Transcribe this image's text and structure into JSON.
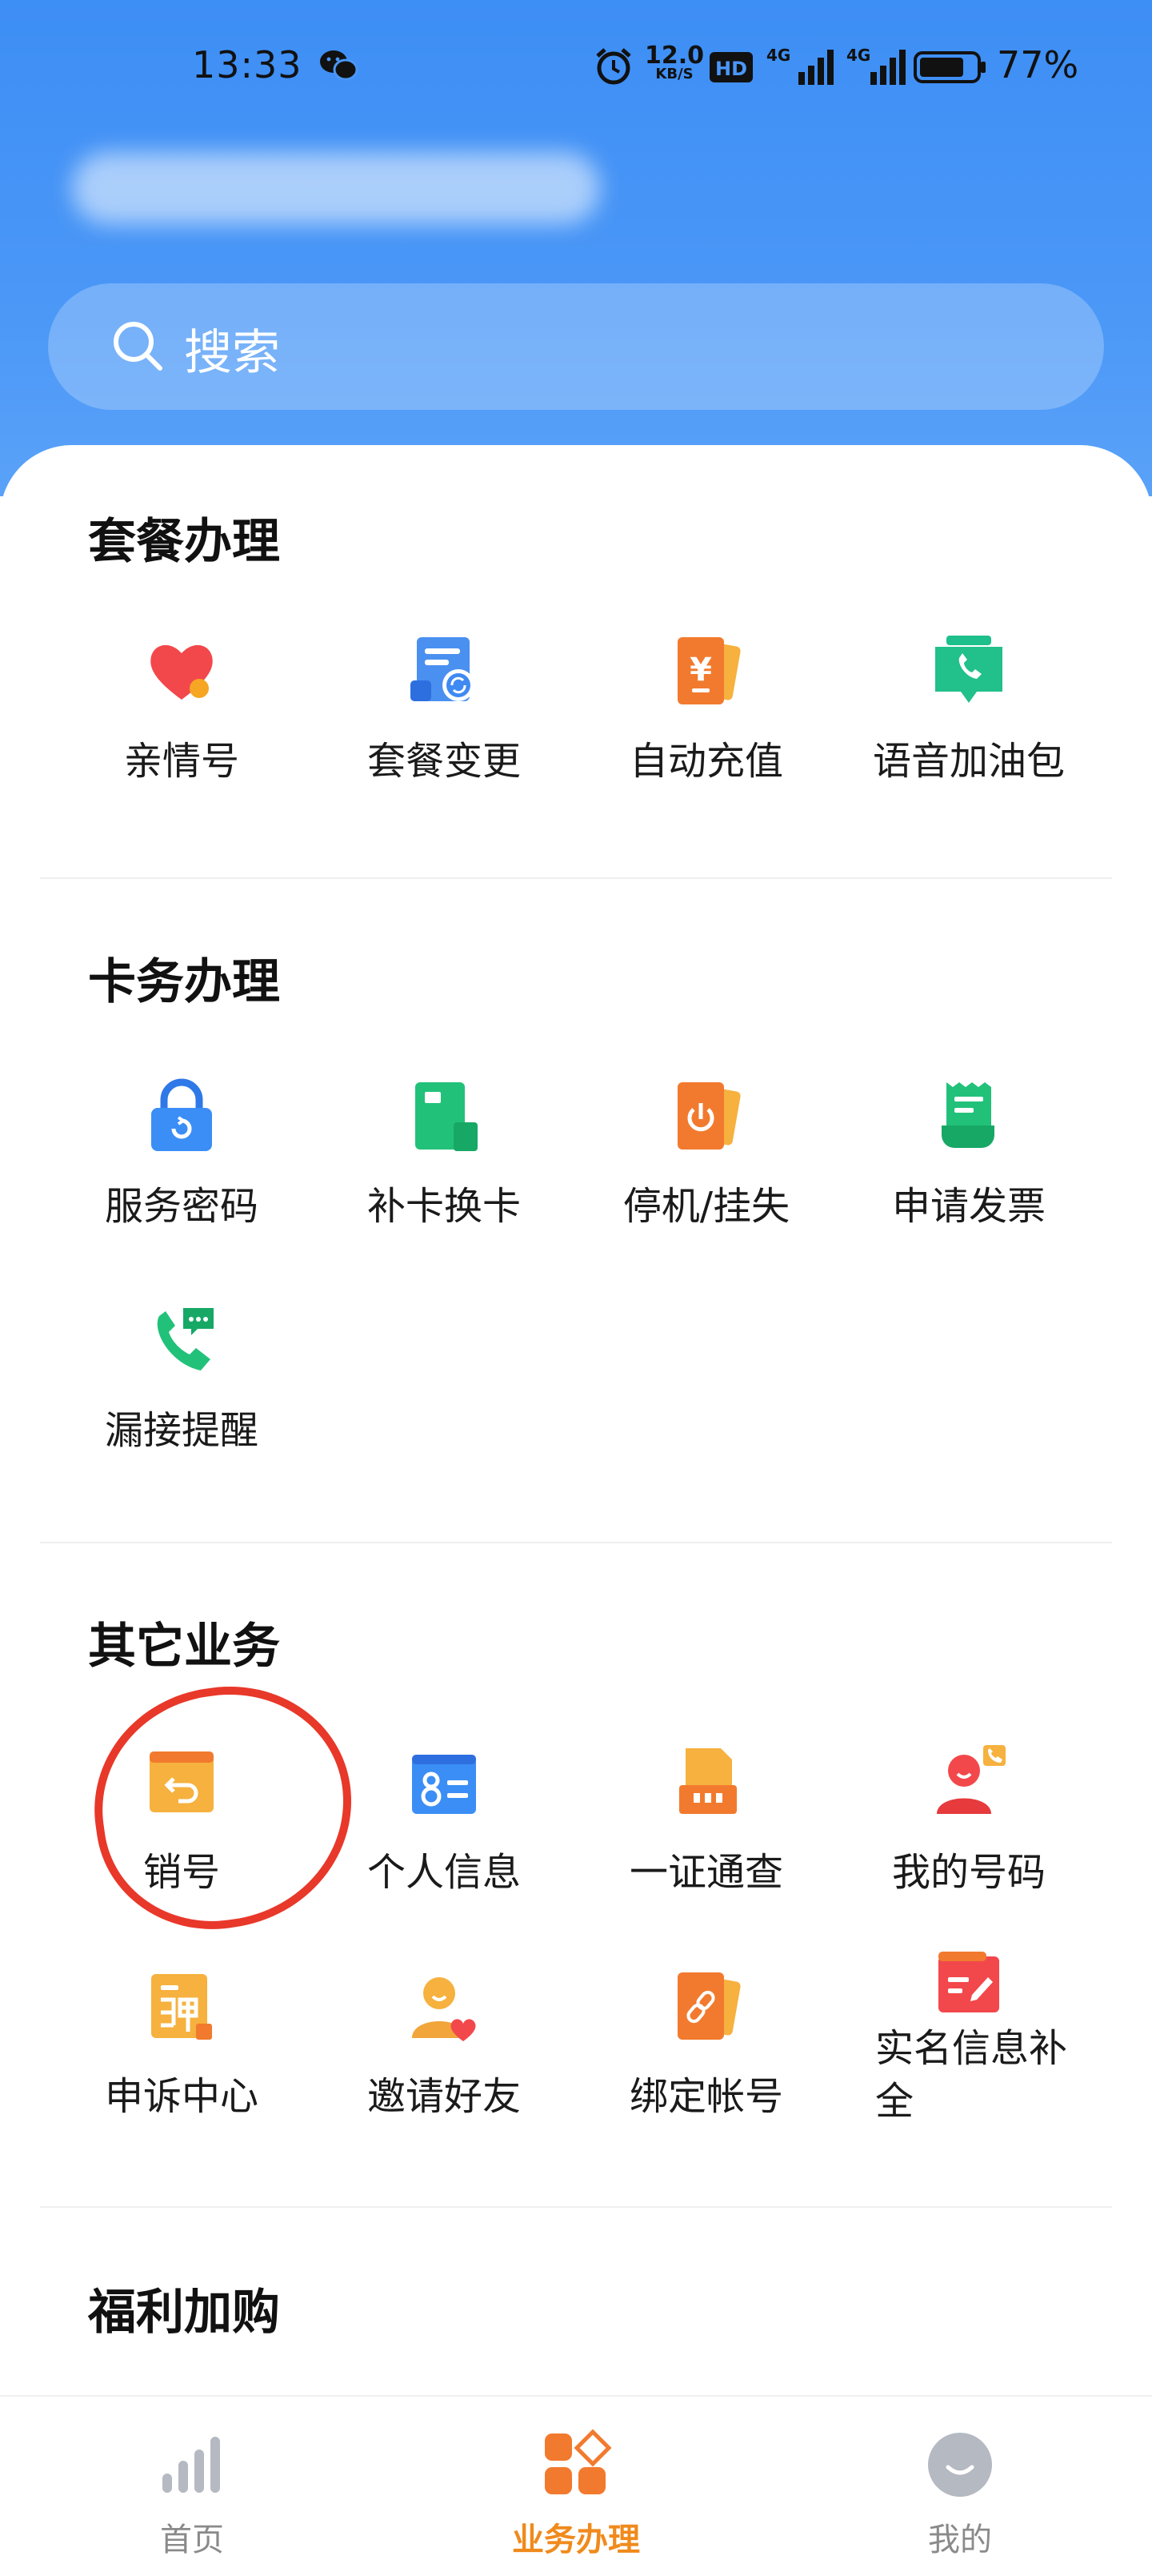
{
  "status_bar": {
    "time": "13:33",
    "speed_value": "12.0",
    "speed_unit": "KB/S",
    "signal_1": "4G",
    "signal_2": "4G",
    "battery": "77%"
  },
  "search": {
    "placeholder": "搜索"
  },
  "sections": {
    "plan": {
      "title": "套餐办理",
      "items": [
        "亲情号",
        "套餐变更",
        "自动充值",
        "语音加油包"
      ]
    },
    "card": {
      "title": "卡务办理",
      "items": [
        "服务密码",
        "补卡换卡",
        "停机/挂失",
        "申请发票",
        "漏接提醒"
      ]
    },
    "other": {
      "title": "其它业务",
      "items": [
        "销号",
        "个人信息",
        "一证通查",
        "我的号码",
        "申诉中心",
        "邀请好友",
        "绑定帐号",
        "实名信息补全"
      ]
    },
    "welfare": {
      "title": "福利加购"
    }
  },
  "bottom_nav": [
    {
      "label": "首页",
      "active": false
    },
    {
      "label": "业务办理",
      "active": true
    },
    {
      "label": "我的",
      "active": false
    }
  ],
  "colors": {
    "header_blue": "#3d8ef5",
    "accent_orange": "#f08a1c",
    "annotation_red": "#e8382a"
  }
}
